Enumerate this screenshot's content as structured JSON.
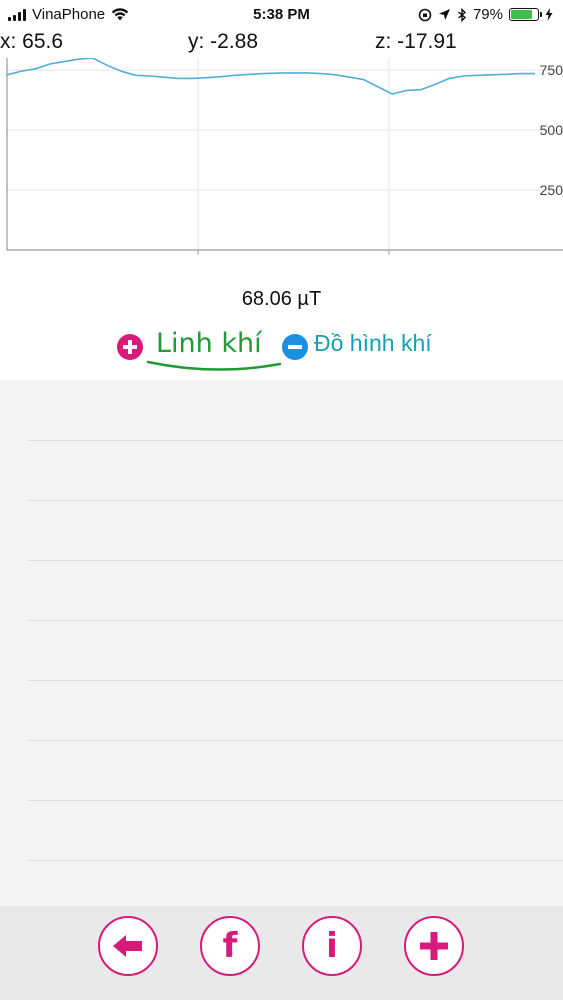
{
  "status_bar": {
    "carrier": "VinaPhone",
    "time": "5:38 PM",
    "battery_percent": "79%",
    "battery_level": 0.79,
    "icons": [
      "signal-icon",
      "wifi-icon",
      "rotation-lock-icon",
      "location-arrow-icon",
      "bluetooth-icon",
      "battery-icon",
      "charging-bolt-icon"
    ]
  },
  "readouts": {
    "x": "x: 65.6",
    "y": "y: -2.88",
    "z": "z: -17.91"
  },
  "chart_data": {
    "type": "line",
    "y_ticks": [
      "750",
      "500",
      "250"
    ],
    "ylim": [
      0,
      800
    ],
    "grid": true,
    "color": "#4fb0d8",
    "series": [
      {
        "values": [
          730,
          745,
          755,
          775,
          785,
          795,
          800,
          770,
          745,
          728,
          725,
          720,
          715,
          715,
          718,
          722,
          728,
          732,
          735,
          737,
          738,
          738,
          735,
          730,
          720,
          710,
          680,
          650,
          665,
          668,
          690,
          715,
          725,
          728,
          730,
          732,
          735,
          735
        ]
      }
    ]
  },
  "magnitude": "68.06 µT",
  "tabs": {
    "active_label": "Linh khí",
    "inactive_label": "Đồ hình khí",
    "accent_green": "#1f9a36",
    "accent_teal": "#17a1b0"
  },
  "list": {
    "row_count": 8
  },
  "bottom_bar": {
    "facebook_letter": "f",
    "info_letter": "i",
    "accent": "#d81b7b"
  }
}
